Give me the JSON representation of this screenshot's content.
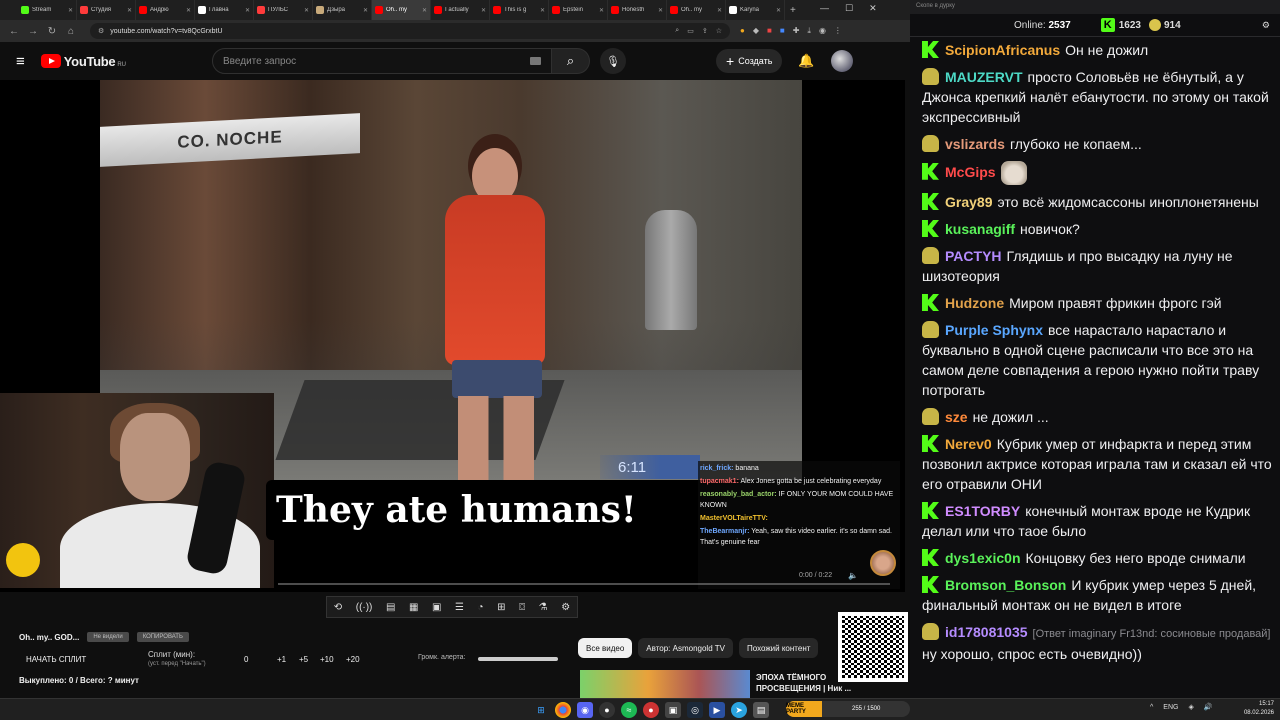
{
  "browser": {
    "tabs": [
      {
        "label": "Stream",
        "color": "#53fc18"
      },
      {
        "label": "Студия",
        "color": "#ff3b3b"
      },
      {
        "label": "Андрю",
        "color": "#ff0000"
      },
      {
        "label": "Главна",
        "color": "#ffffff"
      },
      {
        "label": "ПУЛЬС",
        "color": "#ff3b3b"
      },
      {
        "label": "Дзыра",
        "color": "#c7a97a"
      },
      {
        "label": "Oh.. my",
        "color": "#ff0000",
        "active": true
      },
      {
        "label": "I actually",
        "color": "#ff0000"
      },
      {
        "label": "This is g",
        "color": "#ff0000"
      },
      {
        "label": "Epstein",
        "color": "#ff0000"
      },
      {
        "label": "Honesth",
        "color": "#ff0000"
      },
      {
        "label": "Oh.. my",
        "color": "#ff0000"
      },
      {
        "label": "Karyna",
        "color": "#ffffff"
      }
    ],
    "url": "youtube.com/watch?v=tv8QcGrxbtU"
  },
  "youtube": {
    "logo_text": "YouTube",
    "region": "RU",
    "search_placeholder": "Введите запрос",
    "create_label": "Создать"
  },
  "video": {
    "sign_text": "CO. NOCHE",
    "caption": "They ate humans!",
    "timer_overlay": "6:11",
    "time": "0:00 / 0:22",
    "overlay_chat": [
      {
        "name": "rick_frick:",
        "text": "banana",
        "color": "#6fa8ff"
      },
      {
        "name": "tupacmak1:",
        "text": "Alex Jones gotta be just celebrating everyday",
        "color": "#ff6b6b"
      },
      {
        "name": "reasonably_bad_actor:",
        "text": "IF ONLY YOUR MOM COULD HAVE KNOWN",
        "color": "#9ad36a"
      },
      {
        "name": "MasterVOLTaireTTV:",
        "text": "",
        "color": "#f2c12e"
      },
      {
        "name": "TheBearmanjr:",
        "text": "Yeah, saw this video earlier. it's so damn sad. That's genuine fear",
        "color": "#6fa8ff"
      }
    ]
  },
  "bottom": {
    "title": "Oh.. my.. GOD...",
    "chip1": "Не видели",
    "chip2": "КОПИРОВАТЬ",
    "split_button": "НАЧАТЬ СПЛИТ",
    "split_label": "Сплит (мин):",
    "split_sub": "(уст. перед \"Начать\")",
    "split_values": [
      "0",
      "+1",
      "+5",
      "+10",
      "+20"
    ],
    "alert_label": "Громк. алерта:",
    "bought": "Выкуплено: 0 / Всего: ? минут",
    "filters": [
      "Все видео",
      "Автор: Asmongold TV",
      "Похожий контент"
    ],
    "rec_title": "ЭПОХА ТЁМНОГО ПРОСВЕЩЕНИЯ | Ник ..."
  },
  "chat": {
    "header": "Скопе в дурку",
    "online_label": "Online:",
    "online_value": "2537",
    "k_value": "1623",
    "gift_value": "914",
    "messages": [
      {
        "badge": "k",
        "user": "ScipionAfricanus",
        "color": "#f2a93b",
        "text": "Он не дожил"
      },
      {
        "badge": "g",
        "user": "MAUZERVT",
        "color": "#4dd9c6",
        "text": "просто Соловьёв не ёбнутый, а у Джонса крепкий налёт ебанутости. по этому он такой экспрессивный"
      },
      {
        "badge": "g",
        "user": "vslizards",
        "color": "#e59a7a",
        "text": "глубоко не копаем..."
      },
      {
        "badge": "k",
        "user": "McGips",
        "color": "#ff4b4b",
        "text": "",
        "emote": true
      },
      {
        "badge": "k",
        "user": "Gray89",
        "color": "#f2d27a",
        "text": "это всё жидомсассоны иноплонетянены"
      },
      {
        "badge": "k",
        "user": "kusanagiff",
        "color": "#5af25a",
        "text": "новичок?"
      },
      {
        "badge": "g",
        "user": "PACTYH",
        "color": "#b58cff",
        "text": "Глядишь и про высадку на луну не шизотеория"
      },
      {
        "badge": "k",
        "user": "Hudzone",
        "color": "#e1a24b",
        "text": "Миром правят фрикин фрогс гэй"
      },
      {
        "badge": "g",
        "user": "Purple Sphynx",
        "color": "#5aa7ff",
        "text": "все нарастало нарастало и буквально в одной сцене расписали что все это на самом деле совпадения а герою нужно пойти траву потрогать"
      },
      {
        "badge": "g",
        "user": "sze",
        "color": "#ff8a3b",
        "text": "не дожил ..."
      },
      {
        "badge": "k",
        "user": "Nerev0",
        "color": "#f2a93b",
        "text": "Кубрик умер от инфаркта и перед этим позвонил актрисе которая играла там и сказал ей что его отравили ОНИ"
      },
      {
        "badge": "k",
        "user": "ES1TORBY",
        "color": "#d08cff",
        "text": "конечный монтаж вроде не Кудрик делал или что таое было"
      },
      {
        "badge": "k",
        "user": "dys1exic0n",
        "color": "#5af25a",
        "text": "Концовку без него вроде снимали"
      },
      {
        "badge": "k",
        "user": "Bromson_Bonson",
        "color": "#5af25a",
        "text": "И кубрик умер через 5 дней, финальный монтаж он не видел в итоге"
      },
      {
        "badge": "g",
        "user": "id178081035",
        "color": "#b58cff",
        "reply": "[Ответ imaginary Fr13nd: сосиновые продавай]",
        "text": "ну хорошо, спрос есть очевидно))"
      }
    ]
  },
  "taskbar": {
    "widget_label": "MEME PARTY",
    "widget_value": "255 / 1500",
    "lang": "ENG",
    "time": "15:17",
    "date": "08.02.2026"
  }
}
